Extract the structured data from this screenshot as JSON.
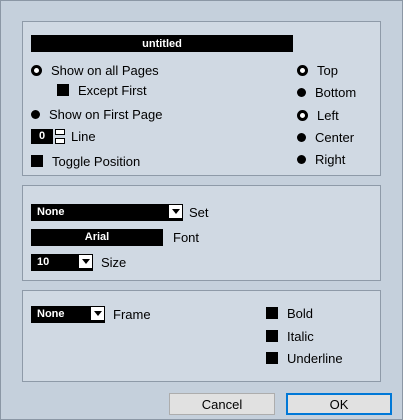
{
  "name_value": "untitled",
  "pages": {
    "show_all": "Show on all Pages",
    "except_first": "Except First",
    "show_first": "Show on First Page",
    "line_value": "0",
    "line_label": "Line",
    "toggle_position": "Toggle Position"
  },
  "position": {
    "top": "Top",
    "bottom": "Bottom",
    "left": "Left",
    "center": "Center",
    "right": "Right"
  },
  "font_group": {
    "set_value": "None",
    "set_label": "Set",
    "font_value": "Arial",
    "font_label": "Font",
    "size_value": "10",
    "size_label": "Size"
  },
  "style_group": {
    "frame_value": "None",
    "frame_label": "Frame",
    "bold": "Bold",
    "italic": "Italic",
    "underline": "Underline"
  },
  "buttons": {
    "cancel": "Cancel",
    "ok": "OK"
  },
  "colors": {
    "background": "#c5d0dc",
    "field": "#000000",
    "ok_border": "#0078d7"
  }
}
